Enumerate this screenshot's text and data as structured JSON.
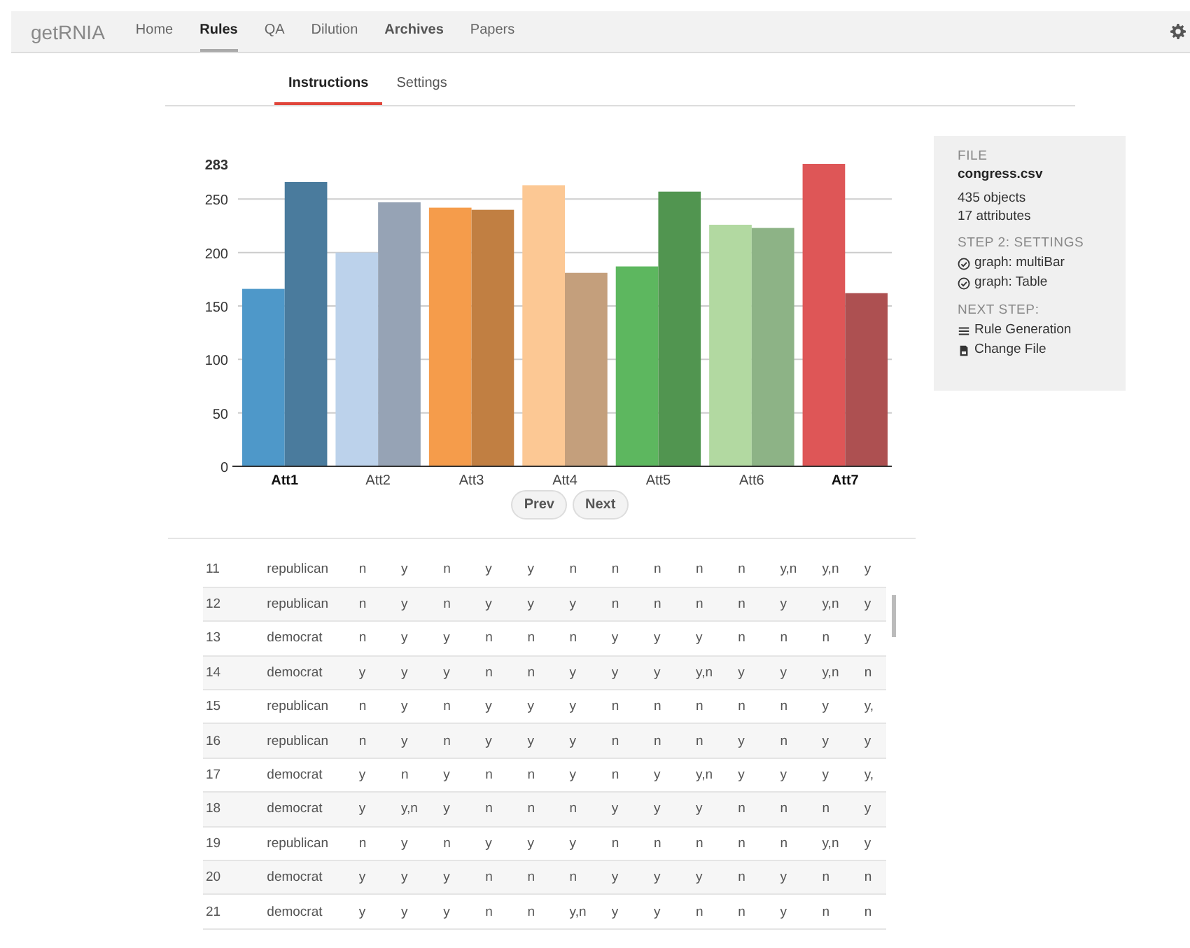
{
  "navbar": {
    "brand": "getRNIA",
    "items": [
      {
        "label": "Home",
        "selected": false,
        "bold": false
      },
      {
        "label": "Rules",
        "selected": true,
        "bold": true
      },
      {
        "label": "QA",
        "selected": false,
        "bold": false
      },
      {
        "label": "Dilution",
        "selected": false,
        "bold": false
      },
      {
        "label": "Archives",
        "selected": false,
        "bold": true
      },
      {
        "label": "Papers",
        "selected": false,
        "bold": false
      }
    ]
  },
  "tabs": [
    {
      "label": "Instructions",
      "selected": true
    },
    {
      "label": "Settings",
      "selected": false
    }
  ],
  "chart": {
    "chart_data": {
      "type": "bar",
      "categories": [
        "Att1",
        "Att2",
        "Att3",
        "Att4",
        "Att5",
        "Att6",
        "Att7"
      ],
      "grid": true,
      "series": [
        {
          "colors": [
            "#4e98c9",
            "#bcd2eb",
            "#f59c4b",
            "#fcc894",
            "#5db75f",
            "#b2d9a1",
            "#de5657"
          ],
          "values": [
            166,
            200,
            242,
            263,
            187,
            226,
            283
          ]
        },
        {
          "colors": [
            "#4a7b9d",
            "#96a3b5",
            "#c17f42",
            "#c49f7c",
            "#519550",
            "#8db386",
            "#ad5051"
          ],
          "values": [
            266,
            247,
            240,
            181,
            257,
            223,
            162
          ]
        }
      ],
      "ylim": [
        0,
        283
      ],
      "yticks": [
        0,
        50,
        100,
        150,
        200,
        250,
        {
          "value": 283,
          "label": "283"
        }
      ]
    },
    "x_label_bold": [
      true,
      false,
      false,
      false,
      false,
      false,
      true
    ],
    "buttons": [
      "Prev",
      "Next"
    ]
  },
  "info": {
    "sections": [
      {
        "heading": "FILE",
        "title": "congress.csv",
        "lines": [
          {
            "kind": "text",
            "text": "435 objects"
          },
          {
            "kind": "text",
            "text": "17 attributes"
          }
        ]
      },
      {
        "heading": "STEP 2: SETTINGS",
        "lines": [
          {
            "kind": "check",
            "text": "graph: multiBar"
          },
          {
            "kind": "check",
            "text": "graph: Table"
          }
        ]
      },
      {
        "heading": "NEXT STEP:",
        "lines": [
          {
            "kind": "list-link",
            "text": "Rule Generation"
          },
          {
            "kind": "file-link",
            "text": "Change File"
          }
        ]
      }
    ]
  },
  "table": {
    "rows": [
      [
        "11",
        "republican",
        "n",
        "y",
        "n",
        "y",
        "y",
        "n",
        "n",
        "n",
        "n",
        "n",
        "y,n",
        "y,n",
        "y"
      ],
      [
        "12",
        "republican",
        "n",
        "y",
        "n",
        "y",
        "y",
        "y",
        "n",
        "n",
        "n",
        "n",
        "y",
        "y,n",
        "y"
      ],
      [
        "13",
        "democrat",
        "n",
        "y",
        "y",
        "n",
        "n",
        "n",
        "y",
        "y",
        "y",
        "n",
        "n",
        "n",
        "y"
      ],
      [
        "14",
        "democrat",
        "y",
        "y",
        "y",
        "n",
        "n",
        "y",
        "y",
        "y",
        "y,n",
        "y",
        "y",
        "y,n",
        "n"
      ],
      [
        "15",
        "republican",
        "n",
        "y",
        "n",
        "y",
        "y",
        "y",
        "n",
        "n",
        "n",
        "n",
        "n",
        "y",
        "y,"
      ],
      [
        "16",
        "republican",
        "n",
        "y",
        "n",
        "y",
        "y",
        "y",
        "n",
        "n",
        "n",
        "y",
        "n",
        "y",
        "y"
      ],
      [
        "17",
        "democrat",
        "y",
        "n",
        "y",
        "n",
        "n",
        "y",
        "n",
        "y",
        "y,n",
        "y",
        "y",
        "y",
        "y,"
      ],
      [
        "18",
        "democrat",
        "y",
        "y,n",
        "y",
        "n",
        "n",
        "n",
        "y",
        "y",
        "y",
        "n",
        "n",
        "n",
        "y"
      ],
      [
        "19",
        "republican",
        "n",
        "y",
        "n",
        "y",
        "y",
        "y",
        "n",
        "n",
        "n",
        "n",
        "n",
        "y,n",
        "y"
      ],
      [
        "20",
        "democrat",
        "y",
        "y",
        "y",
        "n",
        "n",
        "n",
        "y",
        "y",
        "y",
        "n",
        "y",
        "n",
        "n"
      ],
      [
        "21",
        "democrat",
        "y",
        "y",
        "y",
        "n",
        "n",
        "y,n",
        "y",
        "y",
        "n",
        "n",
        "y",
        "n",
        "n"
      ]
    ]
  }
}
